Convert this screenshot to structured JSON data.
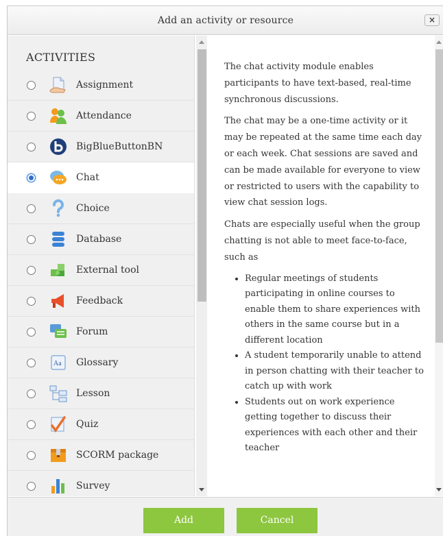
{
  "dialog": {
    "title": "Add an activity or resource",
    "close_label": "×"
  },
  "activities": {
    "heading": "ACTIVITIES",
    "items": [
      {
        "label": "Assignment",
        "icon": "assignment-icon",
        "selected": false
      },
      {
        "label": "Attendance",
        "icon": "attendance-icon",
        "selected": false
      },
      {
        "label": "BigBlueButtonBN",
        "icon": "bigbluebutton-icon",
        "selected": false
      },
      {
        "label": "Chat",
        "icon": "chat-icon",
        "selected": true
      },
      {
        "label": "Choice",
        "icon": "choice-icon",
        "selected": false
      },
      {
        "label": "Database",
        "icon": "database-icon",
        "selected": false
      },
      {
        "label": "External tool",
        "icon": "external-tool-icon",
        "selected": false
      },
      {
        "label": "Feedback",
        "icon": "feedback-icon",
        "selected": false
      },
      {
        "label": "Forum",
        "icon": "forum-icon",
        "selected": false
      },
      {
        "label": "Glossary",
        "icon": "glossary-icon",
        "selected": false
      },
      {
        "label": "Lesson",
        "icon": "lesson-icon",
        "selected": false
      },
      {
        "label": "Quiz",
        "icon": "quiz-icon",
        "selected": false
      },
      {
        "label": "SCORM package",
        "icon": "scorm-icon",
        "selected": false
      },
      {
        "label": "Survey",
        "icon": "survey-icon",
        "selected": false
      }
    ]
  },
  "description": {
    "paragraphs": [
      "The chat activity module enables participants to have text-based, real-time synchronous discussions.",
      "The chat may be a one-time activity or it may be repeated at the same time each day or each week. Chat sessions are saved and can be made available for everyone to view or restricted to users with the capability to view chat session logs.",
      "Chats are especially useful when the group chatting is not able to meet face-to-face, such as"
    ],
    "bullets": [
      "Regular meetings of students participating in online courses to enable them to share experiences with others in the same course but in a different location",
      "A student temporarily unable to attend in person chatting with their teacher to catch up with work",
      "Students out on work experience getting together to discuss their experiences with each other and their teacher"
    ]
  },
  "footer": {
    "add_label": "Add",
    "cancel_label": "Cancel"
  },
  "colors": {
    "button": "#8dc63f",
    "selected_radio": "#2f6fd0"
  }
}
